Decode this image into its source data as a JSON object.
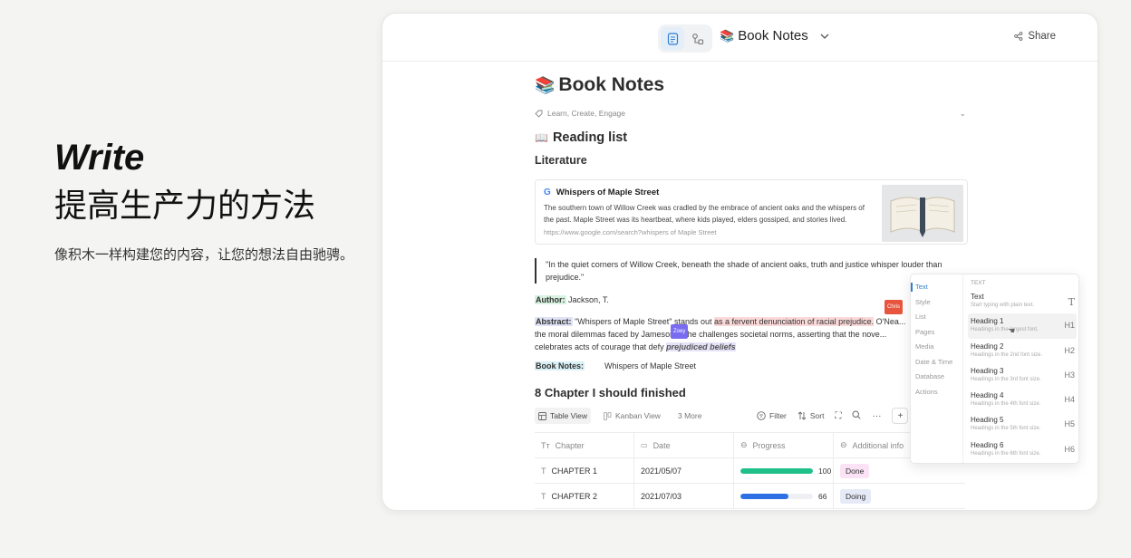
{
  "hero": {
    "title": "Write",
    "subtitle": "提高生产力的方法",
    "description": "像积木一样构建您的内容，让您的想法自由驰骋。"
  },
  "topbar": {
    "doc_title": "Book Notes",
    "share_label": "Share"
  },
  "doc": {
    "title": "Book Notes",
    "meta": "Learn, Create, Engage",
    "reading_list": "Reading list",
    "subheading": "Literature",
    "bookmark": {
      "title": "Whispers of Maple Street",
      "text": "The southern town of Willow Creek was cradled by the embrace of ancient oaks and the whispers of the past. Maple Street was its heartbeat, where kids played, elders gossiped, and stories lived.",
      "url": "https://www.google.com/search?whispers of Maple Street"
    },
    "quote": "\"In the quiet corners of Willow Creek, beneath the shade of ancient oaks, truth and justice whisper louder than prejudice.\"",
    "author_label": "Author:",
    "author_value": " Jackson, T.",
    "abstract_label": "Abstract:",
    "abstract_p1": " \"Whispers of Maple Street\" stands out ",
    "abstract_hl": "as a fervent denunciation of racial prejudice.",
    "abstract_p2": " O'Nea... the moral dilemmas faced by James",
    "abstract_p3": "on as he challenges societal norms, asserting that the nove... celebrates acts of courage that defy ",
    "abstract_hl2": "prejudiced beliefs",
    "cursor_chris": "Chris",
    "cursor_zoey": "Zoey",
    "booknotes_label": "Book Notes:",
    "booknotes_value": "Whispers of Maple Street",
    "section_title": "8 Chapter I should finished"
  },
  "database": {
    "views": [
      "Table View",
      "Kanban View",
      "3 More"
    ],
    "tools": [
      "Filter",
      "Sort"
    ],
    "columns": [
      "Chapter",
      "Date",
      "Progress",
      "Additional info"
    ],
    "rows": [
      {
        "chapter": "CHAPTER 1",
        "date": "2021/05/07",
        "progress": 100,
        "progress_label": "100",
        "status": "Done"
      },
      {
        "chapter": "CHAPTER 2",
        "date": "2021/07/03",
        "progress": 66,
        "progress_label": "66",
        "status": "Doing"
      }
    ]
  },
  "menu": {
    "categories": [
      "Text",
      "Style",
      "List",
      "Pages",
      "Media",
      "Date & Time",
      "Database",
      "Actions"
    ],
    "header": "TEXT",
    "items": [
      {
        "title": "Text",
        "desc": "Start typing with plain text.",
        "key": "T"
      },
      {
        "title": "Heading 1",
        "desc": "Headings in the largest font.",
        "key": "H1"
      },
      {
        "title": "Heading 2",
        "desc": "Headings in the 2nd font size.",
        "key": "H2"
      },
      {
        "title": "Heading 3",
        "desc": "Headings in the 3rd font size.",
        "key": "H3"
      },
      {
        "title": "Heading 4",
        "desc": "Headings in the 4th font size.",
        "key": "H4"
      },
      {
        "title": "Heading 5",
        "desc": "Headings in the 5th font size.",
        "key": "H5"
      },
      {
        "title": "Heading 6",
        "desc": "Headings in the 6th font size.",
        "key": "H6"
      }
    ]
  },
  "colors": {
    "progress_green": "#1fc08a",
    "progress_blue": "#2f6fe4",
    "done_bg": "#fbe3f5",
    "doing_bg": "#e6eaf7",
    "accent": "#2f7fd0",
    "cursor_chris": "#e8553f",
    "cursor_zoey": "#7a6cf0"
  }
}
